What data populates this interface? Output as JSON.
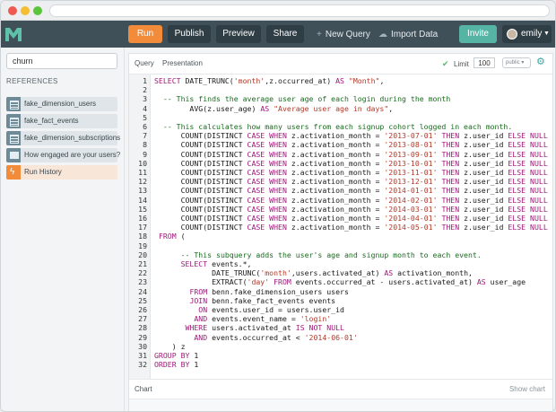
{
  "toolbar": {
    "run": "Run",
    "publish": "Publish",
    "preview": "Preview",
    "share": "Share",
    "new_query": "New Query",
    "import_data": "Import Data",
    "invite": "Invite",
    "username": "emily"
  },
  "sidebar": {
    "search_value": "churn",
    "references_title": "REFERENCES",
    "items": [
      {
        "label": "fake_dimension_users",
        "icon": "table-icon"
      },
      {
        "label": "fake_fact_events",
        "icon": "table-icon"
      },
      {
        "label": "fake_dimension_subscriptions",
        "icon": "table-icon"
      },
      {
        "label": "How engaged are your users?",
        "icon": "query-icon"
      },
      {
        "label": "Run History",
        "icon": "lightning-icon"
      }
    ]
  },
  "editor_header": {
    "tab_query": "Query",
    "tab_presentation": "Presentation",
    "limit_label": "Limit",
    "limit_value": "100",
    "visibility": "public"
  },
  "code_lines": [
    "1",
    "2",
    "3",
    "4",
    "5",
    "6",
    "7",
    "8",
    "9",
    "10",
    "11",
    "12",
    "13",
    "14",
    "15",
    "16",
    "17",
    "18",
    "19",
    "20",
    "21",
    "22",
    "23",
    "24",
    "25",
    "26",
    "27",
    "28",
    "29",
    "30",
    "31",
    "32"
  ],
  "footer": {
    "chart_label": "Chart",
    "show_chart": "Show chart"
  },
  "colors": {
    "nav": "#3f5058",
    "run": "#f28b3a",
    "invite": "#56b4a4",
    "keyword": "#a0177a",
    "string": "#b23a2a",
    "comment": "#1a6a1f"
  }
}
